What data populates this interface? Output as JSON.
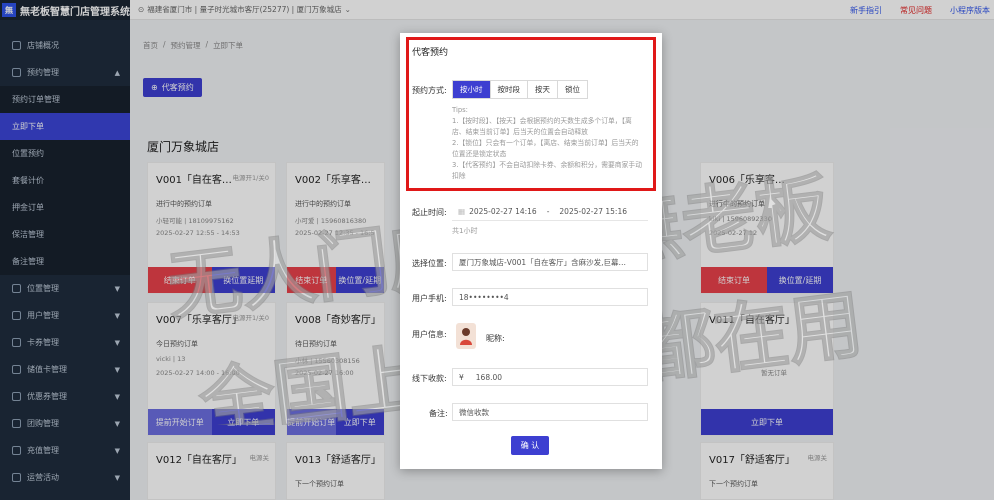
{
  "app": {
    "title": "無老板智慧门店管理系统",
    "logo_text": "無"
  },
  "topbar": {
    "store_path": "福建省厦门市 | 量子时光城市客厅(25277) | 厦门万象城店",
    "links": [
      "新手指引",
      "常见问题",
      "小程序版本"
    ]
  },
  "sidebar": {
    "items": [
      {
        "label": "店铺概况"
      },
      {
        "label": "预约管理"
      },
      {
        "label": "预约订单管理"
      },
      {
        "label": "立即下单"
      },
      {
        "label": "位置预约"
      },
      {
        "label": "套餐计价"
      },
      {
        "label": "押金订单"
      },
      {
        "label": "保洁管理"
      },
      {
        "label": "备注管理"
      },
      {
        "label": "位置管理"
      },
      {
        "label": "用户管理"
      },
      {
        "label": "卡券管理"
      },
      {
        "label": "储值卡管理"
      },
      {
        "label": "优惠券管理"
      },
      {
        "label": "团购管理"
      },
      {
        "label": "充值管理"
      },
      {
        "label": "运营活动"
      }
    ]
  },
  "breadcrumb": [
    "首页",
    "/",
    "预约管理",
    "/",
    "立即下单"
  ],
  "main": {
    "proxy_button": "代客预约",
    "store_title": "厦门万象城店",
    "cards": [
      {
        "title": "V001「自在客…",
        "power": "电源开1/关0",
        "status": "进行中的预约订单",
        "line1": "小轻可能 | 18109975162",
        "line2": "2025-02-27 12:55 - 14:53",
        "buttons": [
          "结束订单",
          "换位置延期"
        ]
      },
      {
        "title": "V002「乐享客…",
        "power": "",
        "status": "进行中的预约订单",
        "line1": "小可爱 | 15960816380",
        "line2": "2025-02-27 12:35 - 16:5",
        "buttons": [
          "结束订单",
          "换位置/延期"
        ]
      },
      {
        "title": "V006「乐享客…",
        "power": "",
        "status": "进行中的预约订单",
        "line1": "kiki | 15960892330",
        "line2": "2025-02-27 12",
        "buttons": [
          "结束订单",
          "换位置/延期"
        ]
      },
      {
        "title": "V007「乐享客厅」",
        "power": "电源开1/关0",
        "status": "今日预约订单",
        "line1": "vicki | 13",
        "line2": "2025-02-27 14:00 - 16:00",
        "buttons": [
          "提前开始订单",
          "立即下单"
        ]
      },
      {
        "title": "V008「奇妙客厅」",
        "power": "",
        "status": "待日预约订单",
        "line1": "小林 | 15560308156",
        "line2": "2025-02-27 16:00",
        "buttons": [
          "提前开始订单",
          "立即下单"
        ]
      },
      {
        "title": "V011「自在客厅」",
        "power": "",
        "status": "",
        "line1": "暂无订单",
        "line2": "",
        "buttons": [
          "立即下单"
        ]
      },
      {
        "title": "V012「自在客厅」",
        "power": "电源关",
        "status": "",
        "line1": "",
        "line2": "",
        "buttons": []
      },
      {
        "title": "V013「舒适客厅」",
        "power": "电源关",
        "status": "下一个预约订单",
        "line1": "",
        "line2": "",
        "buttons": []
      },
      {
        "title": "V017「舒适客厅」",
        "power": "电源关",
        "status": "下一个预约订单",
        "line1": "",
        "line2": "",
        "buttons": []
      }
    ]
  },
  "dialog": {
    "title": "代客预约",
    "mode_label": "预约方式:",
    "modes": [
      "按小时",
      "按时段",
      "按天",
      "锁位"
    ],
    "selected_mode": "按小时",
    "tips": [
      "Tips:",
      "1.【按时段】、【按天】会根据预约的天数生成多个订单，【离店、结束当前订单】后当天的位置会自动释放",
      "2.【锁位】只会有一个订单，【离店、结束当前订单】后当天的位置还是锁定状态",
      "3.【代客预约】不会自动扣除卡券、余额和积分，需要商家手动扣除"
    ],
    "time_label": "起止时间:",
    "start_time": "2025-02-27 14:16",
    "time_sep": "-",
    "end_time": "2025-02-27 15:16",
    "duration": "共1小时",
    "position_label": "选择位置:",
    "position_value": "厦门万象城店-V001「自在客厅」含麻沙发,巨幕…",
    "phone_label": "用户手机:",
    "phone_value": "18••••••••4",
    "info_label": "用户信息:",
    "nickname_label": "昵称:",
    "amount_label": "线下收款:",
    "currency": "¥",
    "amount_value": "168.00",
    "remark_label": "备注:",
    "remark_value": "微信收款",
    "confirm": "确 认"
  },
  "watermark": {
    "line1": "无人门店就选無老板",
    "line2": "全国上万家店都在用"
  }
}
